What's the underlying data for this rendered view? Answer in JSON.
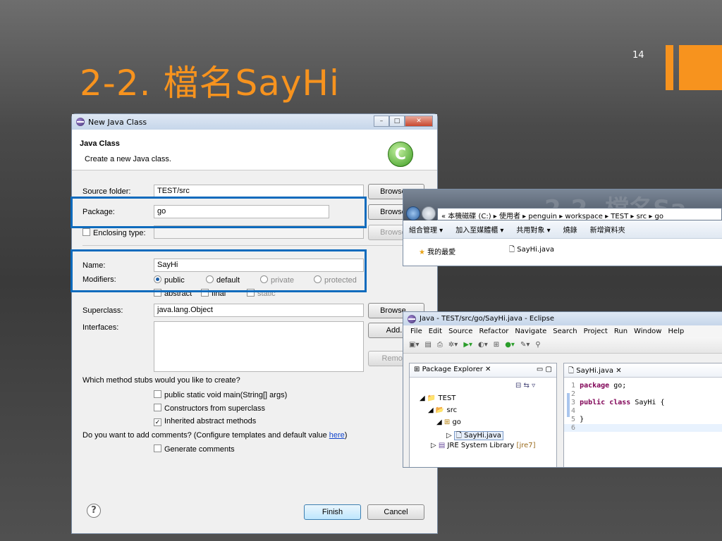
{
  "slide": {
    "title": "2-2. 檔名SayHi",
    "page_number": "14",
    "accent_color": "#f7931e"
  },
  "dialog": {
    "window_title": "New Java Class",
    "header_title": "Java Class",
    "header_subtitle": "Create a new Java class.",
    "source_folder_label": "Source folder:",
    "source_folder_value": "TEST/src",
    "package_label": "Package:",
    "package_value": "go",
    "enclosing_label": "Enclosing type:",
    "name_label": "Name:",
    "name_value": "SayHi",
    "modifiers_label": "Modifiers:",
    "mod_public": "public",
    "mod_default": "default",
    "mod_private": "private",
    "mod_protected": "protected",
    "mod_abstract": "abstract",
    "mod_final": "final",
    "mod_static": "static",
    "superclass_label": "Superclass:",
    "superclass_value": "java.lang.Object",
    "interfaces_label": "Interfaces:",
    "browse_label": "Browse...",
    "add_label": "Add...",
    "remove_label": "Remove",
    "stubs_question": "Which method stubs would you like to create?",
    "stub_main": "public static void main(String[] args)",
    "stub_constructors": "Constructors from superclass",
    "stub_inherited": "Inherited abstract methods",
    "comments_question_prefix": "Do you want to add comments? (Configure templates and default value ",
    "comments_link": "here",
    "comments_question_suffix": ")",
    "generate_comments": "Generate comments",
    "finish_label": "Finish",
    "cancel_label": "Cancel",
    "help_symbol": "?"
  },
  "explorer": {
    "ghost_title": "2-2. 檔名Sa",
    "address": "« 本機磁碟 (C:) ▸ 使用者 ▸ penguin ▸ workspace ▸ TEST ▸ src ▸ go",
    "toolbar_items": [
      "組合管理 ▾",
      "加入至媒體櫃 ▾",
      "共用對象 ▾",
      "燒錄",
      "新增資料夾"
    ],
    "favorites": "我的最愛",
    "file_name": "SayHi.java"
  },
  "eclipse": {
    "window_title": "Java - TEST/src/go/SayHi.java - Eclipse",
    "menu": [
      "File",
      "Edit",
      "Source",
      "Refactor",
      "Navigate",
      "Search",
      "Project",
      "Run",
      "Window",
      "Help"
    ],
    "package_explorer_tab": "Package Explorer",
    "tree_project": "TEST",
    "tree_src": "src",
    "tree_package": "go",
    "tree_file": "SayHi.java",
    "tree_jre": "JRE System Library",
    "tree_jre_version": "[jre7]",
    "editor_tab": "SayHi.java",
    "code_lines": [
      {
        "num": "1",
        "kw": "package",
        "rest": " go;"
      },
      {
        "num": "2",
        "kw": "",
        "rest": ""
      },
      {
        "num": "3",
        "kw": "public class",
        "rest": " SayHi {"
      },
      {
        "num": "4",
        "kw": "",
        "rest": ""
      },
      {
        "num": "5",
        "kw": "",
        "rest": "}"
      },
      {
        "num": "6",
        "kw": "",
        "rest": ""
      }
    ]
  }
}
